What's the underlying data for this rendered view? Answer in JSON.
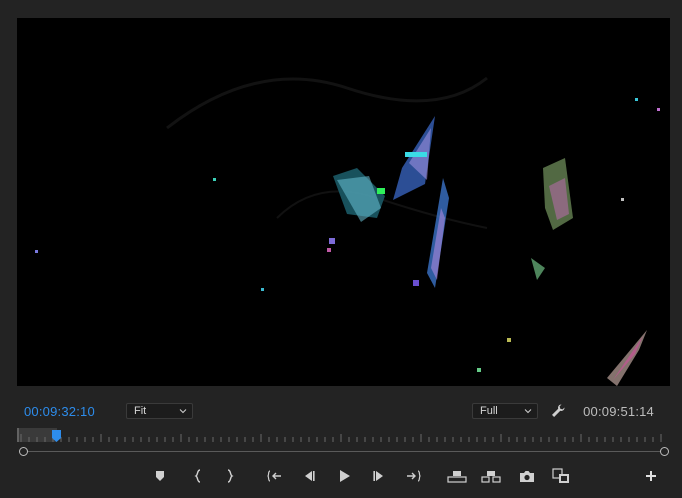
{
  "monitor": {
    "current_timecode": "00:09:32:10",
    "duration_timecode": "00:09:51:14",
    "zoom_select": {
      "value": "Fit"
    },
    "resolution_select": {
      "value": "Full"
    },
    "playhead_color": "#2d8ceb"
  },
  "transport": {
    "buttons": [
      {
        "name": "add-marker-button",
        "icon": "marker-icon"
      },
      {
        "name": "mark-in-button",
        "icon": "mark-in-icon"
      },
      {
        "name": "mark-out-button",
        "icon": "mark-out-icon"
      },
      {
        "name": "go-to-in-button",
        "icon": "go-to-in-icon"
      },
      {
        "name": "step-back-button",
        "icon": "step-back-icon"
      },
      {
        "name": "play-button",
        "icon": "play-icon"
      },
      {
        "name": "step-forward-button",
        "icon": "step-forward-icon"
      },
      {
        "name": "go-to-out-button",
        "icon": "go-to-out-icon"
      },
      {
        "name": "lift-button",
        "icon": "lift-icon"
      },
      {
        "name": "extract-button",
        "icon": "extract-icon"
      },
      {
        "name": "export-frame-button",
        "icon": "camera-icon"
      },
      {
        "name": "comparison-view-button",
        "icon": "comparison-view-icon"
      },
      {
        "name": "button-editor-button",
        "icon": "plus-icon"
      }
    ]
  },
  "colors": {
    "panel_bg": "#232323",
    "accent_blue": "#2d8ceb",
    "text": "#cfcfcf"
  }
}
